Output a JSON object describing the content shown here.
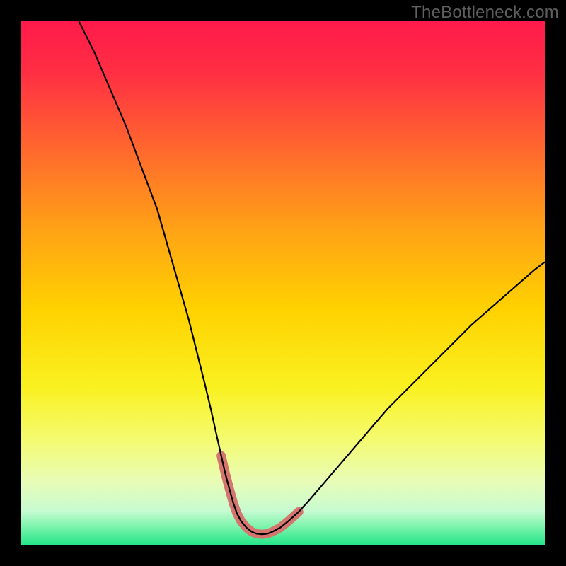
{
  "watermark": "TheBottleneck.com",
  "chart_data": {
    "type": "line",
    "title": "",
    "xlabel": "",
    "ylabel": "",
    "xlim": [
      0,
      100
    ],
    "ylim": [
      0,
      100
    ],
    "background_gradient_stops": [
      {
        "offset": 0.0,
        "color": "#ff1a4b"
      },
      {
        "offset": 0.1,
        "color": "#ff2f43"
      },
      {
        "offset": 0.25,
        "color": "#ff6a2d"
      },
      {
        "offset": 0.4,
        "color": "#ffa315"
      },
      {
        "offset": 0.55,
        "color": "#ffd200"
      },
      {
        "offset": 0.7,
        "color": "#faf121"
      },
      {
        "offset": 0.8,
        "color": "#f4fb71"
      },
      {
        "offset": 0.88,
        "color": "#e8fcb7"
      },
      {
        "offset": 0.935,
        "color": "#c7fbd1"
      },
      {
        "offset": 0.965,
        "color": "#7df4ad"
      },
      {
        "offset": 1.0,
        "color": "#24e588"
      }
    ],
    "series": [
      {
        "name": "bottleneck-curve",
        "stroke": "#000000",
        "stroke_width": 2.2,
        "x": [
          11,
          14,
          17,
          20,
          23,
          26,
          28,
          30,
          32,
          33.5,
          35,
          36.2,
          37.3,
          38.2,
          39,
          39.8,
          40.5,
          41.2,
          42,
          43,
          44,
          45,
          46,
          47,
          48,
          49.5,
          51,
          53,
          55,
          58,
          61,
          64,
          67,
          70,
          74,
          78,
          82,
          86,
          90,
          94,
          98,
          100
        ],
        "y": [
          100,
          94,
          87,
          80,
          72,
          64,
          57,
          50,
          43,
          37,
          31,
          26,
          21,
          17,
          13.5,
          10.5,
          8,
          6,
          4.5,
          3.3,
          2.5,
          2.1,
          2.0,
          2.1,
          2.5,
          3.3,
          4.5,
          6.3,
          8.5,
          12,
          15.5,
          19,
          22.5,
          26,
          30,
          34,
          38,
          42,
          45.5,
          49,
          52.5,
          54
        ]
      },
      {
        "name": "highlight-band",
        "stroke": "#d4756e",
        "stroke_width": 13,
        "linecap": "round",
        "x": [
          38.2,
          39,
          39.8,
          40.5,
          41.2,
          42,
          43,
          44,
          45,
          46,
          47,
          48,
          49.5,
          51,
          53
        ],
        "y": [
          17,
          13.5,
          10.5,
          8,
          6,
          4.5,
          3.3,
          2.5,
          2.1,
          2.0,
          2.1,
          2.5,
          3.3,
          4.5,
          6.3
        ]
      }
    ]
  }
}
